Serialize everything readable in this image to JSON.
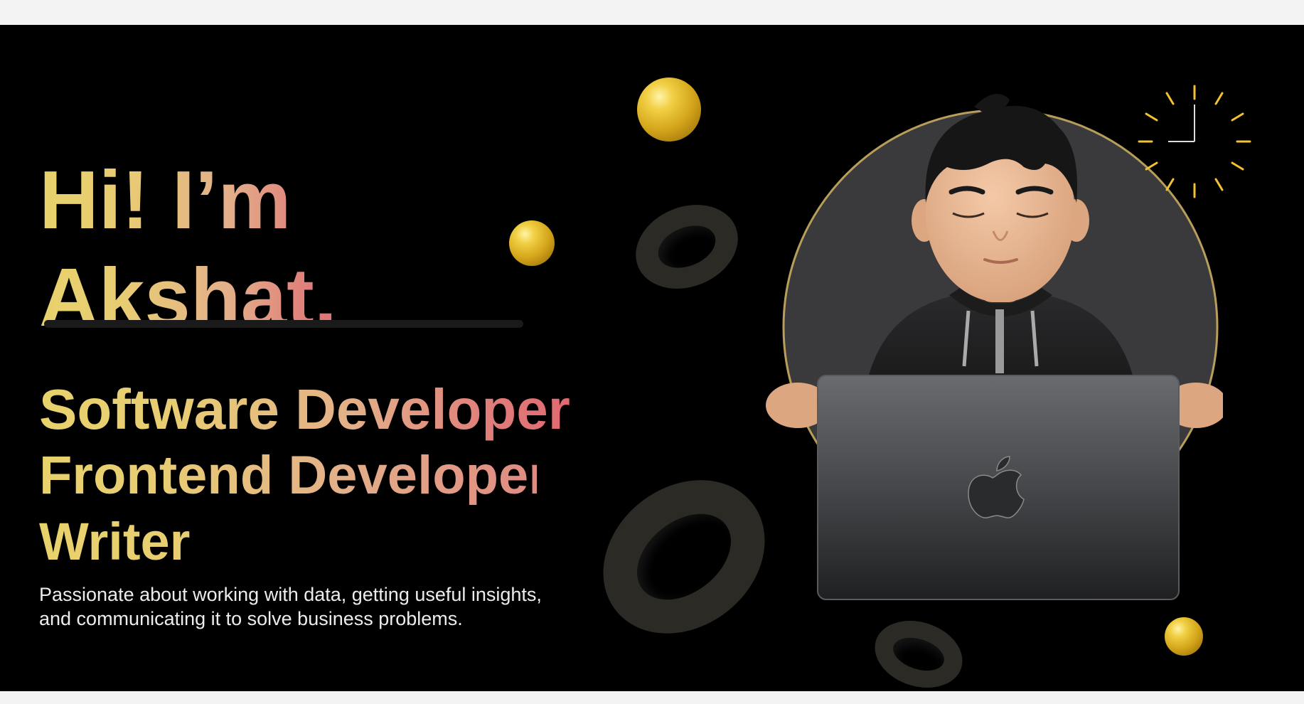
{
  "hero": {
    "greeting_line1": "Hi! I’m",
    "greeting_line2": "Akshat.",
    "roles": [
      "Software Developer",
      "Frontend Developer",
      "Writer"
    ],
    "bio_line1": "Passionate about working with data, getting useful insights,",
    "bio_line2": "and communicating it to solve business problems."
  },
  "colors": {
    "background": "#000000",
    "page_bg": "#f3f3f3",
    "gradient_start": "#e8d26c",
    "gradient_end": "#e0606a",
    "clock_accent": "#f2c230"
  },
  "icons": [
    "clock-icon",
    "apple-logo-icon",
    "memoji-avatar"
  ]
}
